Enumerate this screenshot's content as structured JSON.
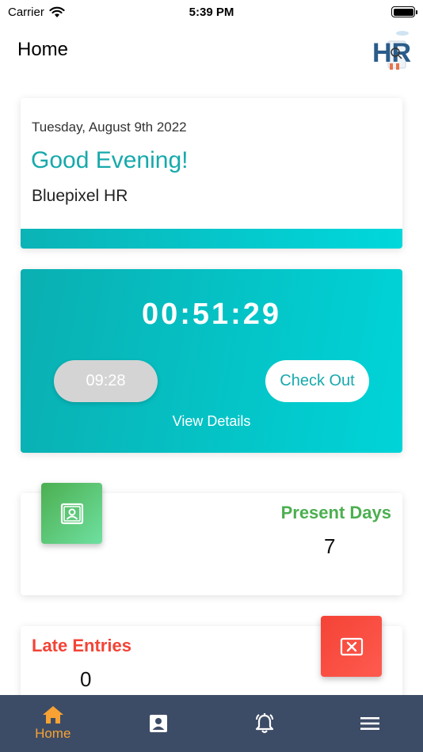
{
  "status_bar": {
    "carrier": "Carrier",
    "time": "5:39 PM"
  },
  "header": {
    "title": "Home",
    "logo_text": "HR"
  },
  "greeting": {
    "date": "Tuesday, August 9th 2022",
    "message": "Good Evening!",
    "company": "Bluepixel HR"
  },
  "attendance": {
    "elapsed": "00:51:29",
    "checkin_time": "09:28",
    "checkout_label": "Check Out",
    "view_details_label": "View Details"
  },
  "stats": {
    "present_label": "Present Days",
    "present_value": "7",
    "late_label": "Late Entries",
    "late_value": "0"
  },
  "bottom_nav": {
    "items": [
      {
        "label": "Home",
        "icon": "home-icon",
        "active": true
      },
      {
        "label": "",
        "icon": "contact-card-icon",
        "active": false
      },
      {
        "label": "",
        "icon": "alarm-bell-icon",
        "active": false
      },
      {
        "label": "",
        "icon": "menu-icon",
        "active": false
      }
    ]
  },
  "colors": {
    "accent": "#17a9ac",
    "nav_bg": "#3d4c66",
    "nav_active": "#f7a233",
    "present": "#4caf50",
    "late": "#f44336"
  }
}
